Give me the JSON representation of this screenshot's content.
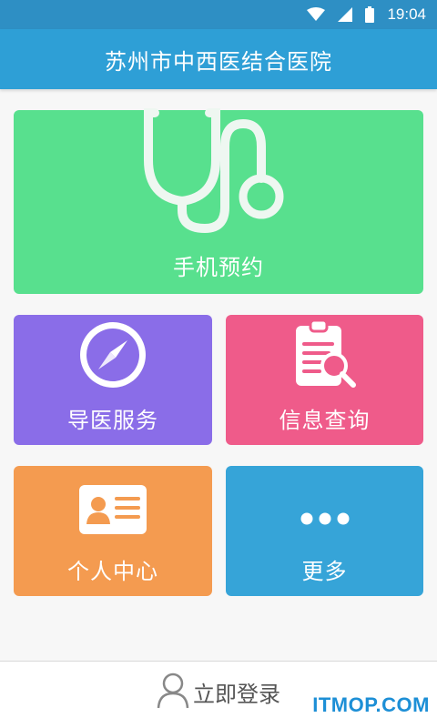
{
  "status_bar": {
    "time": "19:04",
    "icons": [
      "wifi-icon",
      "signal-icon",
      "battery-icon"
    ],
    "color": "#2e8fc4"
  },
  "app_bar": {
    "title": "苏州市中西医结合医院",
    "color": "#2e9fd6"
  },
  "tiles": [
    {
      "label": "手机预约",
      "icon": "stethoscope-icon",
      "color": "#58e08e"
    },
    {
      "label": "导医服务",
      "icon": "compass-icon",
      "color": "#8a6de8"
    },
    {
      "label": "信息查询",
      "icon": "clipboard-search-icon",
      "color": "#ef5b8a"
    },
    {
      "label": "个人中心",
      "icon": "id-card-icon",
      "color": "#f49b50"
    },
    {
      "label": "更多",
      "icon": "more-dots-icon",
      "color": "#36a4d8"
    }
  ],
  "bottom_bar": {
    "login_label": "立即登录",
    "icon": "user-icon"
  },
  "watermark": "ITMOP.COM"
}
